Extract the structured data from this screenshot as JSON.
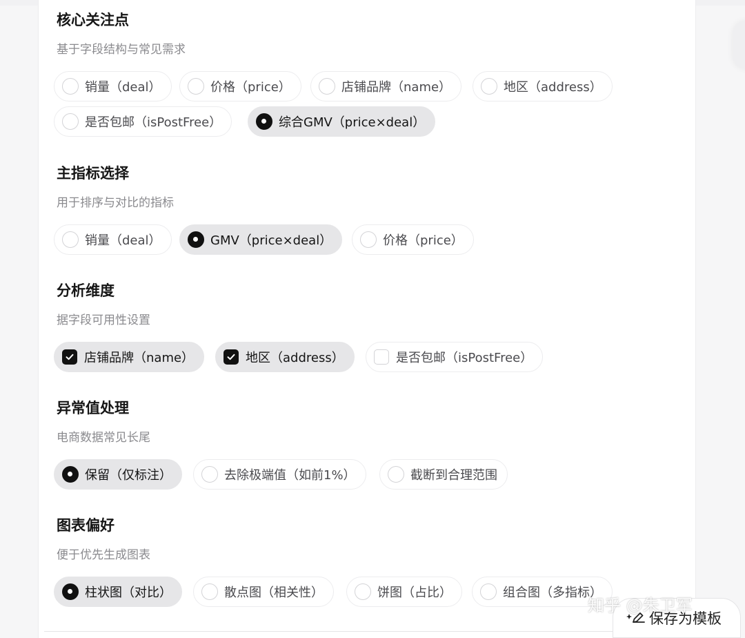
{
  "sections": [
    {
      "title": "核心关注点",
      "subtitle": "基于字段结构与常见需求",
      "options": [
        "销量（deal）",
        "价格（price）",
        "店铺品牌（name）",
        "地区（address）",
        "是否包邮（isPostFree）",
        "综合GMV（price×deal）"
      ],
      "selected": "综合GMV（price×deal）"
    },
    {
      "title": "主指标选择",
      "subtitle": "用于排序与对比的指标",
      "options": [
        "销量（deal）",
        "GMV（price×deal）",
        "价格（price）"
      ],
      "selected": "GMV（price×deal）"
    },
    {
      "title": "分析维度",
      "subtitle": "据字段可用性设置",
      "options": [
        "店铺品牌（name）",
        "地区（address）",
        "是否包邮（isPostFree）"
      ],
      "checked": [
        "店铺品牌（name）",
        "地区（address）"
      ]
    },
    {
      "title": "异常值处理",
      "subtitle": "电商数据常见长尾",
      "options": [
        "保留（仅标注）",
        "去除极端值（如前1%）",
        "截断到合理范围"
      ],
      "selected": "保留（仅标注）"
    },
    {
      "title": "图表偏好",
      "subtitle": "便于优先生成图表",
      "options": [
        "柱状图（对比）",
        "散点图（相关性）",
        "饼图（占比）",
        "组合图（多指标）"
      ],
      "selected": "柱状图（对比）"
    }
  ],
  "footer": {
    "save_template_label": "保存为模板",
    "save_icon": "sparkle-edit-icon"
  },
  "watermark": "知乎 @朱卫军",
  "colors": {
    "selected_chip_bg": "#e6e6e8",
    "control_on": "#111111",
    "subtitle_text": "#8a8a8e"
  }
}
